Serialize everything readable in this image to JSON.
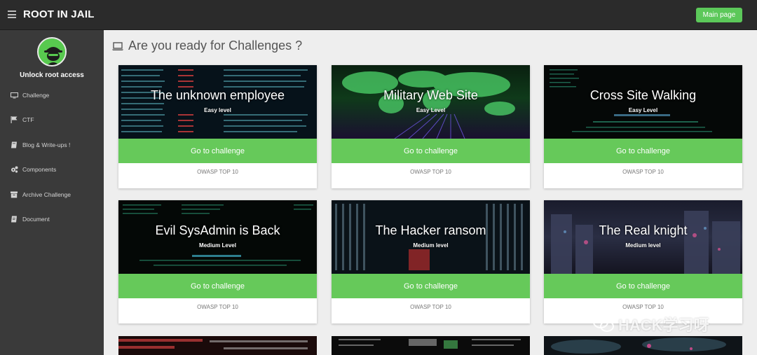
{
  "header": {
    "brand": "ROOT IN JAIL",
    "main_page_label": "Main page"
  },
  "sidebar": {
    "user_label": "Unlock root access",
    "items": [
      {
        "label": "Challenge",
        "icon": "desktop-icon"
      },
      {
        "label": "CTF",
        "icon": "flag-icon"
      },
      {
        "label": "Blog & Write-ups !",
        "icon": "book-icon"
      },
      {
        "label": "Components",
        "icon": "gears-icon"
      },
      {
        "label": "Archive Challenge",
        "icon": "archive-icon"
      },
      {
        "label": "Document",
        "icon": "document-icon"
      }
    ]
  },
  "main": {
    "heading": "Are you ready for Challenges ?",
    "cards": [
      {
        "title": "The unknown employee",
        "level": "Easy level",
        "button": "Go to challenge",
        "tag": "OWASP TOP 10"
      },
      {
        "title": "Military Web Site",
        "level": "Easy Level",
        "button": "Go to challenge",
        "tag": "OWASP TOP 10"
      },
      {
        "title": "Cross Site Walking",
        "level": "Easy Level",
        "button": "Go to challenge",
        "tag": "OWASP TOP 10"
      },
      {
        "title": "Evil SysAdmin is Back",
        "level": "Medium Level",
        "button": "Go to challenge",
        "tag": "OWASP TOP 10"
      },
      {
        "title": "The Hacker ransom",
        "level": "Medium level",
        "button": "Go to challenge",
        "tag": "OWASP TOP 10"
      },
      {
        "title": "The Real knight",
        "level": "Medium level",
        "button": "Go to challenge",
        "tag": "OWASP TOP 10"
      }
    ]
  },
  "watermark": {
    "text": "HACK学习呀"
  },
  "colors": {
    "accent": "#66c95a",
    "topbar": "#2b2b2b",
    "sidebar": "#3a3a3a",
    "background": "#eeeeee"
  }
}
